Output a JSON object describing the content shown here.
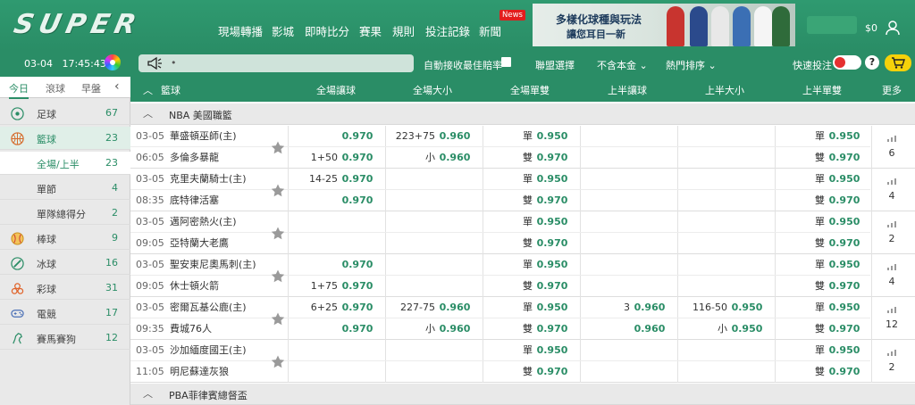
{
  "logo_text": "SUPER",
  "nav": [
    "現場轉播",
    "影城",
    "即時比分",
    "賽果",
    "規則",
    "投注記錄",
    "新聞"
  ],
  "news_badge": "News",
  "banner": {
    "line1": "多樣化球種與玩法",
    "line2": "讓您耳目一新"
  },
  "balance": "$0",
  "date": "03-04",
  "time": "17:45:43",
  "marquee": "•",
  "subbar": {
    "auto_accept": "自動接收最佳賠率",
    "league_select": "聯盟選擇",
    "principal": "不含本金",
    "sort": "熱門排序",
    "quick_bet": "快速投注"
  },
  "sidebar": {
    "tabs": [
      "今日",
      "滾球",
      "早盤"
    ],
    "items": [
      {
        "label": "足球",
        "count": "67"
      },
      {
        "label": "籃球",
        "count": "23"
      },
      {
        "label": "全場/上半",
        "count": "23"
      },
      {
        "label": "單節",
        "count": "4"
      },
      {
        "label": "單隊總得分",
        "count": "2"
      },
      {
        "label": "棒球",
        "count": "9"
      },
      {
        "label": "冰球",
        "count": "16"
      },
      {
        "label": "彩球",
        "count": "31"
      },
      {
        "label": "電競",
        "count": "17"
      },
      {
        "label": "賽馬賽狗",
        "count": "12"
      }
    ]
  },
  "table": {
    "sport": "籃球",
    "columns": [
      "全場讓球",
      "全場大小",
      "全場單雙",
      "上半讓球",
      "上半大小",
      "上半單雙",
      "更多"
    ],
    "leagues": [
      "NBA 美國職籃",
      "PBA菲律賓總督盃"
    ],
    "matches": [
      {
        "date": "03-05",
        "time": "06:05",
        "home": "華盛頓巫師(主)",
        "away": "多倫多暴龍",
        "fh": [
          "",
          "0.970",
          "1+50",
          "0.970"
        ],
        "ou": [
          "223+75",
          "0.960",
          "小",
          "0.960"
        ],
        "oe": [
          "單",
          "0.950",
          "雙",
          "0.970"
        ],
        "hh": [
          "",
          "",
          "",
          ""
        ],
        "hou": [
          "",
          "",
          "",
          ""
        ],
        "hoe": [
          "單",
          "0.950",
          "雙",
          "0.970"
        ],
        "more": "6"
      },
      {
        "date": "03-05",
        "time": "08:35",
        "home": "克里夫蘭騎士(主)",
        "away": "底特律活塞",
        "fh": [
          "14-25",
          "0.970",
          "",
          "0.970"
        ],
        "ou": [
          "",
          "",
          "",
          ""
        ],
        "oe": [
          "單",
          "0.950",
          "雙",
          "0.970"
        ],
        "hh": [
          "",
          "",
          "",
          ""
        ],
        "hou": [
          "",
          "",
          "",
          ""
        ],
        "hoe": [
          "單",
          "0.950",
          "雙",
          "0.970"
        ],
        "more": "4"
      },
      {
        "date": "03-05",
        "time": "09:05",
        "home": "邁阿密熱火(主)",
        "away": "亞特蘭大老鷹",
        "fh": [
          "",
          "",
          "",
          ""
        ],
        "ou": [
          "",
          "",
          "",
          ""
        ],
        "oe": [
          "單",
          "0.950",
          "雙",
          "0.970"
        ],
        "hh": [
          "",
          "",
          "",
          ""
        ],
        "hou": [
          "",
          "",
          "",
          ""
        ],
        "hoe": [
          "單",
          "0.950",
          "雙",
          "0.970"
        ],
        "more": "2"
      },
      {
        "date": "03-05",
        "time": "09:05",
        "home": "聖安東尼奧馬刺(主)",
        "away": "休士頓火箭",
        "fh": [
          "",
          "0.970",
          "1+75",
          "0.970"
        ],
        "ou": [
          "",
          "",
          "",
          ""
        ],
        "oe": [
          "單",
          "0.950",
          "雙",
          "0.970"
        ],
        "hh": [
          "",
          "",
          "",
          ""
        ],
        "hou": [
          "",
          "",
          "",
          ""
        ],
        "hoe": [
          "單",
          "0.950",
          "雙",
          "0.970"
        ],
        "more": "4"
      },
      {
        "date": "03-05",
        "time": "09:35",
        "home": "密爾瓦基公鹿(主)",
        "away": "費城76人",
        "fh": [
          "6+25",
          "0.970",
          "",
          "0.970"
        ],
        "ou": [
          "227-75",
          "0.960",
          "小",
          "0.960"
        ],
        "oe": [
          "單",
          "0.950",
          "雙",
          "0.970"
        ],
        "hh": [
          "3",
          "0.960",
          "",
          "0.960"
        ],
        "hou": [
          "116-50",
          "0.950",
          "小",
          "0.950"
        ],
        "hoe": [
          "單",
          "0.950",
          "雙",
          "0.970"
        ],
        "more": "12"
      },
      {
        "date": "03-05",
        "time": "11:05",
        "home": "沙加緬度國王(主)",
        "away": "明尼蘇達灰狼",
        "fh": [
          "",
          "",
          "",
          ""
        ],
        "ou": [
          "",
          "",
          "",
          ""
        ],
        "oe": [
          "單",
          "0.950",
          "雙",
          "0.970"
        ],
        "hh": [
          "",
          "",
          "",
          ""
        ],
        "hou": [
          "",
          "",
          "",
          ""
        ],
        "hoe": [
          "單",
          "0.950",
          "雙",
          "0.970"
        ],
        "more": "2"
      }
    ]
  },
  "colors": {
    "brand": "#2a8d66",
    "odds": "#2a8d66",
    "header": "#2a8d66"
  }
}
